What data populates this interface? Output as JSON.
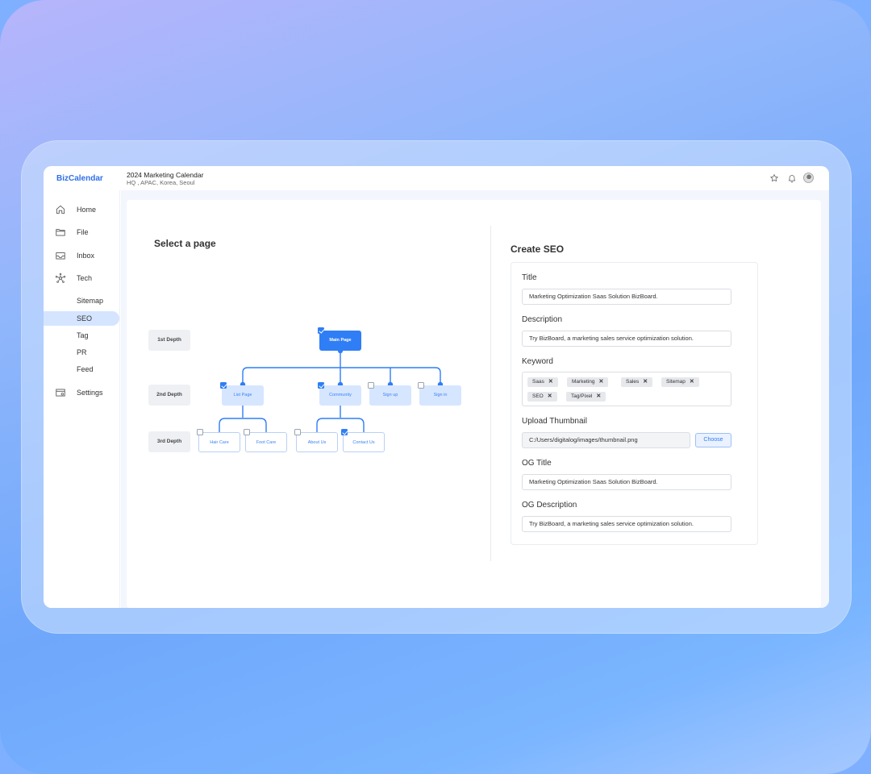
{
  "app": {
    "logo": "BizCalendar",
    "project_title": "2024 Marketing Calendar",
    "project_location": "HQ , APAC, Korea, Seoul"
  },
  "header_icons": [
    "star-icon",
    "bell-icon",
    "avatar"
  ],
  "sidebar": {
    "items": [
      {
        "label": "Home",
        "icon": "home-icon"
      },
      {
        "label": "File",
        "icon": "folder-icon"
      },
      {
        "label": "Inbox",
        "icon": "inbox-icon"
      },
      {
        "label": "Tech",
        "icon": "network-icon"
      }
    ],
    "sub_items": [
      {
        "label": "Sitemap",
        "active": false
      },
      {
        "label": "SEO",
        "active": true
      },
      {
        "label": "Tag",
        "active": false
      },
      {
        "label": "PR",
        "active": false
      },
      {
        "label": "Feed",
        "active": false
      }
    ],
    "settings": {
      "label": "Settings",
      "icon": "settings-icon"
    }
  },
  "select_page": {
    "heading": "Select a page",
    "depths": [
      "1st Depth",
      "2nd Depth",
      "3rd Depth"
    ],
    "nodes": {
      "main": {
        "label": "Main Page",
        "checked": true
      },
      "list_page": {
        "label": "List Page",
        "checked": true
      },
      "community": {
        "label": "Community",
        "checked": true
      },
      "sign_up": {
        "label": "Sign up",
        "checked": false
      },
      "sign_in": {
        "label": "Sign in",
        "checked": false
      },
      "hair_care": {
        "label": "Hair Care",
        "checked": false
      },
      "foot_care": {
        "label": "Foot Care",
        "checked": false
      },
      "about_us": {
        "label": "About Us",
        "checked": false
      },
      "contact_us": {
        "label": "Contact Us",
        "checked": true
      }
    }
  },
  "seo_form": {
    "heading": "Create SEO",
    "title_label": "Title",
    "title_value": "Marketing Optimization Saas Solution BizBoard.",
    "description_label": "Description",
    "description_value": "Try BizBoard, a marketing sales service optimization solution.",
    "keyword_label": "Keyword",
    "keywords": [
      "Saas",
      "Marketing",
      "Sales",
      "Sitemap",
      "SEO",
      "Tag/Pixel"
    ],
    "remove_glyph": "✕",
    "thumbnail_label": "Upload Thumbnail",
    "thumbnail_path": "C:/Users/digitalog/images/thumbnail.png",
    "choose_label": "Choose",
    "og_title_label": "OG Title",
    "og_title_value": "Marketing Optimization Saas Solution BizBoard.",
    "og_description_label": "OG Description",
    "og_description_value": "Try BizBoard, a marketing sales service optimization solution."
  },
  "colors": {
    "accent": "#2f7ef5",
    "active_bg": "#d5e5ff"
  }
}
